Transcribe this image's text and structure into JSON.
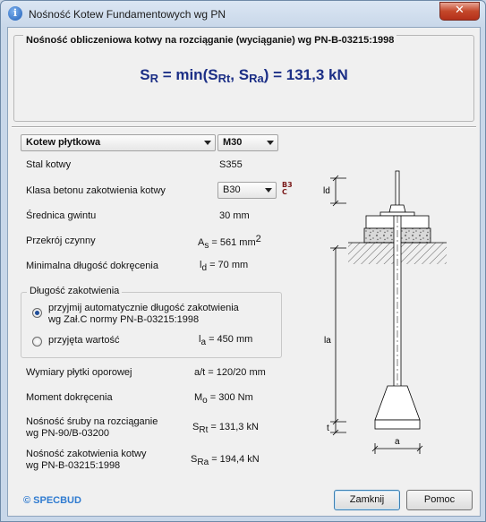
{
  "window": {
    "title": "Nośność Kotew Fundamentowych wg PN",
    "close_glyph": "✕",
    "app_icon_letter": "i"
  },
  "summary": {
    "legend": "Nośność obliczeniowa kotwy na rozciąganie (wyciąganie) wg PN-B-03215:1998",
    "formula": {
      "lhs": "S",
      "lhs_sub": "R",
      "mid": " = min(S",
      "sub1": "Rt",
      "comma": ", S",
      "sub2": "Ra",
      "rhs": ") = 131,3 kN"
    }
  },
  "anchor_type": {
    "selected": "Kotew płytkowa"
  },
  "thread": {
    "selected": "M30"
  },
  "rows": {
    "steel": {
      "label": "Stal kotwy",
      "value": "S355"
    },
    "concrete": {
      "label": "Klasa betonu zakotwienia kotwy",
      "selected": "B30",
      "icon_text": "B3\nC"
    },
    "diameter": {
      "label": "Średnica gwintu",
      "value": "30 mm"
    },
    "section": {
      "label": "Przekrój czynny",
      "sym": "A",
      "sym_sub": "s",
      "value": " = 561 mm",
      "sup": "2"
    },
    "min_length": {
      "label": "Minimalna długość dokręcenia",
      "sym": "l",
      "sym_sub": "d",
      "value": " = 70 mm"
    }
  },
  "anchorage_length": {
    "legend": "Długość zakotwienia",
    "option_auto": "przyjmij automatycznie długość zakotwienia\nwg Zał.C normy PN-B-03215:1998",
    "option_manual": "przyjęta wartość",
    "auto_selected": true,
    "sym": "l",
    "sym_sub": "a",
    "value": " = 450 mm"
  },
  "plate": {
    "label": "Wymiary płytki oporowej",
    "sym": "a/t",
    "value": " = 120/20 mm"
  },
  "moment": {
    "label": "Moment dokręcenia",
    "sym": "M",
    "sym_sub": "o",
    "value": " = 300 Nm"
  },
  "bolt_capacity": {
    "label": "Nośność śruby na rozciąganie\nwg PN-90/B-03200",
    "sym": "S",
    "sym_sub": "Rt",
    "value": " = 131,3 kN"
  },
  "anchor_capacity": {
    "label": "Nośność zakotwienia kotwy\nwg PN-B-03215:1998",
    "sym": "S",
    "sym_sub": "Ra",
    "value": " = 194,4 kN"
  },
  "diagram": {
    "ld": "ld",
    "la": "la",
    "t": "t",
    "a": "a"
  },
  "footer": {
    "brand": "© SPECBUD",
    "close_label": "Zamknij",
    "help_label": "Pomoc"
  }
}
